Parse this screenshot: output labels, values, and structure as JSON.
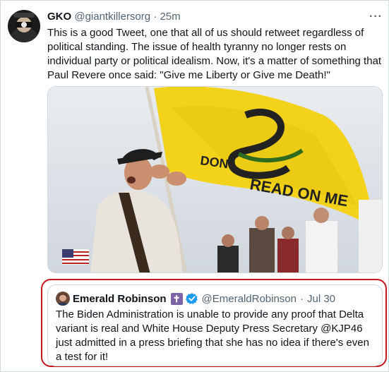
{
  "tweet": {
    "author_name": "GKO",
    "author_handle": "@giantkillersorg",
    "separator": "·",
    "time": "25m",
    "more_label": "···",
    "text": "This is a good Tweet, one that all of us should retweet regardless of political standing. The issue of health tyranny no longer rests on individual party or political idealism. Now, it's a matter of something that Paul Revere once said: \"Give me Liberty or Give me Death!\"",
    "media": {
      "flag_text_line1": "DON",
      "flag_text_line2": "READ ON ME"
    }
  },
  "quote": {
    "author_name": "Emerald Robinson",
    "badge": "✝",
    "author_handle": "@EmeraldRobinson",
    "separator": "·",
    "date": "Jul 30",
    "text": "The Biden Administration is unable to provide any proof that Delta variant is real and White House Deputy Press Secretary @KJP46 just admitted in a press briefing that she has no idea if there's even a test for it!"
  },
  "colors": {
    "highlight_outline": "#c4161c",
    "verified_blue": "#1d9bf0",
    "flag_yellow": "#f2d21a"
  }
}
